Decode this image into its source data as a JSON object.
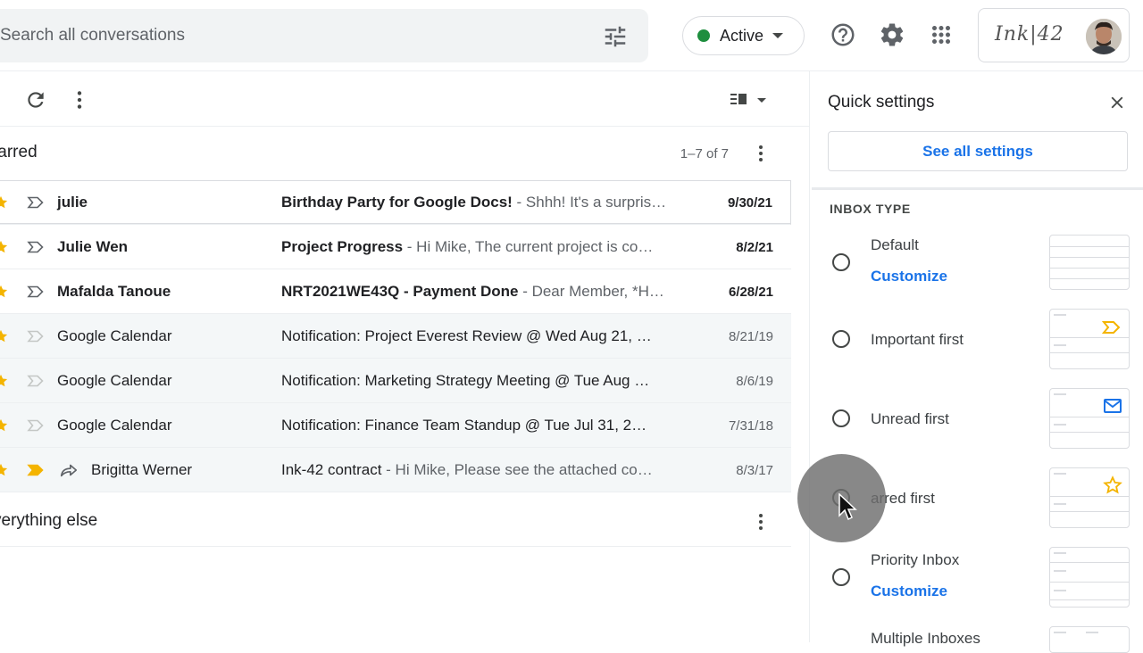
{
  "search": {
    "placeholder": "Search all conversations"
  },
  "status": {
    "label": "Active",
    "color": "#1e8e3e"
  },
  "header_icons": [
    "tune-icon",
    "help-icon",
    "settings-gear-icon",
    "apps-grid-icon"
  ],
  "brand": {
    "logo_text": "Ink|42"
  },
  "toolbar_icons": [
    "refresh-icon",
    "more-vert-icon",
    "split-pane-toggle-icon"
  ],
  "sections": {
    "starred": {
      "title": "tarred",
      "count": "1–7 of 7"
    },
    "everything_else": {
      "title": "verything else"
    }
  },
  "emails": [
    {
      "sender": "julie",
      "subject": "Birthday Party for Google Docs!",
      "snippet": " - Shhh! It's a surpris…",
      "date": "9/30/21",
      "unread": true,
      "important": false,
      "forwarded": false
    },
    {
      "sender": "Julie Wen",
      "subject": "Project Progress",
      "snippet": " - Hi Mike, The current project is co…",
      "date": "8/2/21",
      "unread": true,
      "important": false,
      "forwarded": false
    },
    {
      "sender": "Mafalda Tanoue",
      "subject": "NRT2021WE43Q - Payment Done",
      "snippet": " - Dear Member, *H…",
      "date": "6/28/21",
      "unread": true,
      "important": false,
      "forwarded": false
    },
    {
      "sender": "Google Calendar",
      "subject": "Notification: Project Everest Review @ Wed Aug 21, …",
      "snippet": "",
      "date": "8/21/19",
      "unread": false,
      "important": false,
      "forwarded": false
    },
    {
      "sender": "Google Calendar",
      "subject": "Notification: Marketing Strategy Meeting @ Tue Aug …",
      "snippet": "",
      "date": "8/6/19",
      "unread": false,
      "important": false,
      "forwarded": false
    },
    {
      "sender": "Google Calendar",
      "subject": "Notification: Finance Team Standup @ Tue Jul 31, 2…",
      "snippet": "",
      "date": "7/31/18",
      "unread": false,
      "important": false,
      "forwarded": false
    },
    {
      "sender": "Brigitta Werner",
      "subject": "Ink-42 contract",
      "snippet": " - Hi Mike, Please see the attached co…",
      "date": "8/3/17",
      "unread": false,
      "important": true,
      "forwarded": true
    }
  ],
  "quick_settings": {
    "title": "Quick settings",
    "see_all": "See all settings",
    "section_label": "INBOX TYPE",
    "options": [
      {
        "label": "Default",
        "link": "Customize",
        "badge": ""
      },
      {
        "label": "Important first",
        "link": "",
        "badge": "important-marker-icon"
      },
      {
        "label": "Unread first",
        "link": "",
        "badge": "envelope-icon"
      },
      {
        "label": "arred first",
        "link": "",
        "badge": "star-outline-icon"
      },
      {
        "label": "Priority Inbox",
        "link": "Customize",
        "badge": ""
      },
      {
        "label": "Multiple Inboxes",
        "link": "",
        "badge": ""
      }
    ]
  },
  "colors": {
    "accent": "#1a73e8",
    "star": "#f4b400",
    "active": "#1e8e3e"
  }
}
